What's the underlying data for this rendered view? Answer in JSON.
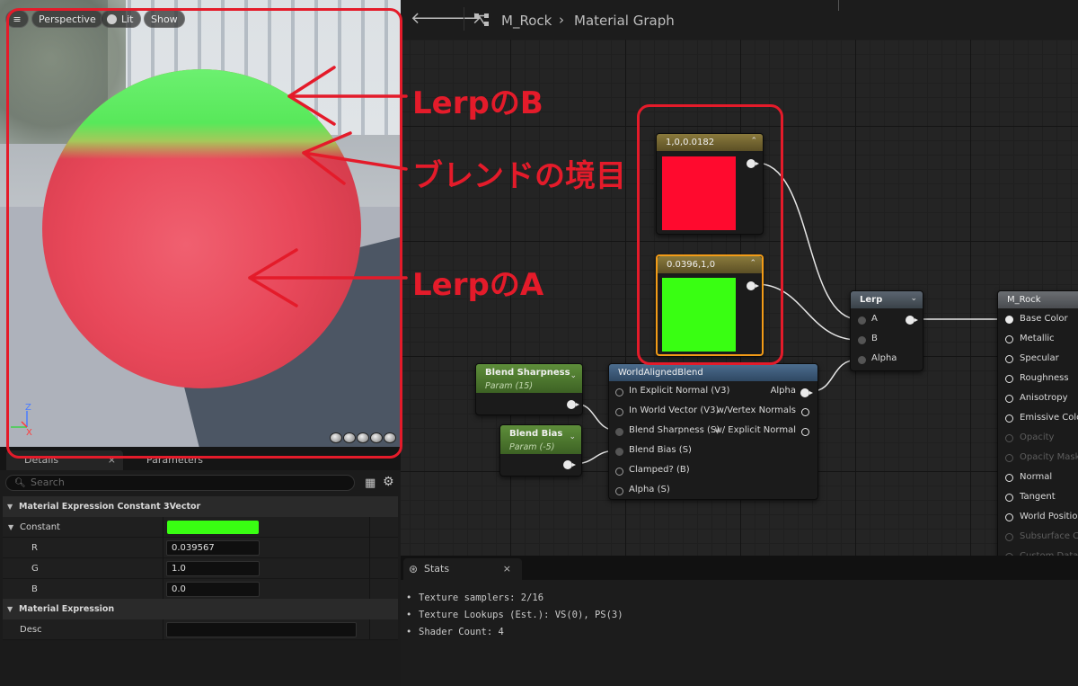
{
  "viewport": {
    "menu_icon": "hamburger-icon",
    "perspective_label": "Perspective",
    "lit_label": "Lit",
    "show_label": "Show",
    "axis_z": "Z",
    "axis_x": "X"
  },
  "annotations": {
    "lerp_b": "LerpのB",
    "blend_boundary": "ブレンドの境目",
    "lerp_a": "LerpのA",
    "color": "#e41b2a"
  },
  "toolbar": {
    "asset_name": "M_Rock",
    "graph_name": "Material Graph",
    "chevron": "›"
  },
  "nodes": {
    "constant_red": {
      "title": "1,0,0.0182",
      "color": "#ff0a2e"
    },
    "constant_green": {
      "title": "0.0396,1,0",
      "color": "#39ff12"
    },
    "blend_sharpness": {
      "title": "Blend Sharpness",
      "subtitle": "Param (15)"
    },
    "blend_bias": {
      "title": "Blend Bias",
      "subtitle": "Param (-5)"
    },
    "world_aligned_blend": {
      "title": "WorldAlignedBlend",
      "inputs": [
        "In Explicit Normal (V3)",
        "In World Vector (V3)",
        "Blend Sharpness (S)",
        "Blend Bias (S)",
        "Clamped? (B)",
        "Alpha (S)"
      ],
      "outputs": [
        "Alpha",
        "w/Vertex Normals",
        "w/ Explicit Normal"
      ]
    },
    "lerp": {
      "title": "Lerp",
      "inputs": [
        "A",
        "B",
        "Alpha"
      ]
    },
    "result": {
      "title": "M_Rock",
      "inputs": [
        "Base Color",
        "Metallic",
        "Specular",
        "Roughness",
        "Anisotropy",
        "Emissive Color",
        "Opacity",
        "Opacity Mask",
        "Normal",
        "Tangent",
        "World Position",
        "Subsurface Co",
        "Custom Data"
      ]
    }
  },
  "details": {
    "tab_details": "Details",
    "tab_params": "Parameters",
    "search_placeholder": "Search",
    "section1": "Material Expression Constant 3Vector",
    "constant_label": "Constant",
    "constant_color": "#39ff12",
    "r_label": "R",
    "r_value": "0.039567",
    "g_label": "G",
    "g_value": "1.0",
    "b_label": "B",
    "b_value": "0.0",
    "section2": "Material Expression",
    "desc_label": "Desc",
    "desc_value": ""
  },
  "stats": {
    "tab_label": "Stats",
    "lines": [
      "Texture samplers: 2/16",
      "Texture Lookups (Est.): VS(0), PS(3)",
      "Shader Count: 4"
    ]
  }
}
